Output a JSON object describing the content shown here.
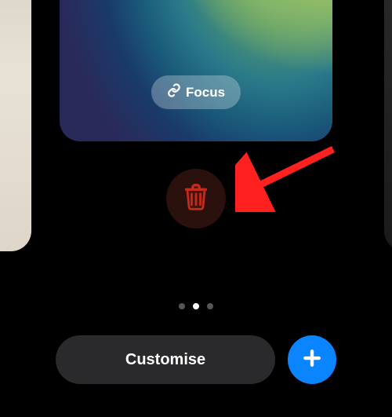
{
  "focus": {
    "label": "Focus"
  },
  "buttons": {
    "customise": "Customise"
  },
  "icons": {
    "link": "link-icon",
    "trash": "trash-icon",
    "plus": "plus-icon"
  },
  "pagination": {
    "total": 3,
    "active": 2
  },
  "colors": {
    "accent": "#0a84ff",
    "delete": "#c62b1a",
    "arrow": "#ff2020"
  }
}
